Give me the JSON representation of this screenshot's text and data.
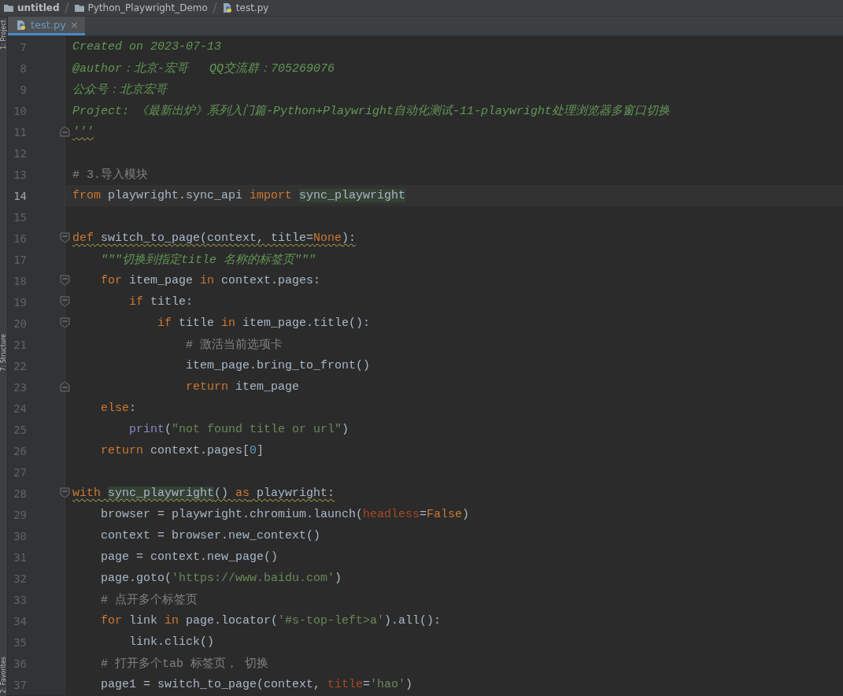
{
  "breadcrumbs": [
    {
      "label": "untitled",
      "kind": "project"
    },
    {
      "label": "Python_Playwright_Demo",
      "kind": "folder"
    },
    {
      "label": "test.py",
      "kind": "file"
    }
  ],
  "side_tools": [
    {
      "label": "1: Project"
    },
    {
      "label": "7: Structure"
    },
    {
      "label": "2: Favorites"
    }
  ],
  "tabs": [
    {
      "label": "test.py",
      "close": "×",
      "selected": true
    }
  ],
  "lines": [
    {
      "number": "7",
      "current": false,
      "underlined": false,
      "tokens": [
        {
          "kind": "doc",
          "text": "Created on 2023-07-13"
        }
      ]
    },
    {
      "number": "8",
      "current": false,
      "underlined": false,
      "tokens": [
        {
          "kind": "doc",
          "text": "@author：北京-宏哥   QQ交流群：705269076"
        }
      ]
    },
    {
      "number": "9",
      "current": false,
      "underlined": false,
      "tokens": [
        {
          "kind": "doc",
          "text": "公众号：北京宏哥"
        }
      ]
    },
    {
      "number": "10",
      "current": false,
      "underlined": false,
      "tokens": [
        {
          "kind": "doc",
          "text": "Project: 《最新出炉》系列入门篇-Python+Playwright自动化测试-11-playwright处理浏览器多窗口切换"
        }
      ]
    },
    {
      "number": "11",
      "current": false,
      "fold_marker": {
        "kind": "end"
      },
      "underlined": true,
      "tokens": [
        {
          "kind": "doc",
          "text": "'''"
        }
      ]
    },
    {
      "number": "12",
      "current": false
    },
    {
      "number": "13",
      "current": false,
      "underlined": false,
      "tokens": [
        {
          "kind": "comment",
          "text": "# 3.导入模块"
        }
      ]
    },
    {
      "number": "14",
      "current": true,
      "underlined": false,
      "tokens": [
        {
          "kind": "kw",
          "text": "from"
        },
        {
          "kind": "plain",
          "text": " playwright.sync_api "
        },
        {
          "kind": "kw",
          "text": "import"
        },
        {
          "kind": "usage",
          "text": " sync_playwright"
        }
      ]
    },
    {
      "number": "15",
      "current": false
    },
    {
      "number": "16",
      "current": false,
      "fold_marker": {
        "kind": "start"
      },
      "underlined": true,
      "tokens": [
        {
          "kind": "kw",
          "text": "def"
        },
        {
          "kind": "plain",
          "text": " switch_to_page(context, title="
        },
        {
          "kind": "kw",
          "text": "None"
        },
        {
          "kind": "plain",
          "text": "):"
        }
      ]
    },
    {
      "number": "17",
      "current": false,
      "underlined": false,
      "tokens": [
        {
          "kind": "doc",
          "text": "    \"\"\"切换到指定title 名称的标签页\"\"\""
        }
      ]
    },
    {
      "number": "18",
      "current": false,
      "fold_marker": {
        "kind": "start"
      },
      "underlined": false,
      "tokens": [
        {
          "kind": "kw",
          "text": "    for"
        },
        {
          "kind": "plain",
          "text": " item_page "
        },
        {
          "kind": "kw",
          "text": "in"
        },
        {
          "kind": "plain",
          "text": " context.pages:"
        }
      ]
    },
    {
      "number": "19",
      "current": false,
      "fold_marker": {
        "kind": "start"
      },
      "underlined": false,
      "tokens": [
        {
          "kind": "kw",
          "text": "        if"
        },
        {
          "kind": "plain",
          "text": " title:"
        }
      ]
    },
    {
      "number": "20",
      "current": false,
      "fold_marker": {
        "kind": "start"
      },
      "underlined": false,
      "tokens": [
        {
          "kind": "kw",
          "text": "            if"
        },
        {
          "kind": "plain",
          "text": " title "
        },
        {
          "kind": "kw",
          "text": "in"
        },
        {
          "kind": "plain",
          "text": " item_page.title():"
        }
      ]
    },
    {
      "number": "21",
      "current": false,
      "underlined": false,
      "tokens": [
        {
          "kind": "comment",
          "text": "                # 激活当前选项卡"
        }
      ]
    },
    {
      "number": "22",
      "current": false,
      "underlined": false,
      "tokens": [
        {
          "kind": "plain",
          "text": "                item_page.bring_to_front()"
        }
      ]
    },
    {
      "number": "23",
      "current": false,
      "fold_marker": {
        "kind": "end"
      },
      "underlined": false,
      "tokens": [
        {
          "kind": "kw",
          "text": "                return"
        },
        {
          "kind": "plain",
          "text": " item_page"
        }
      ]
    },
    {
      "number": "24",
      "current": false,
      "underlined": false,
      "tokens": [
        {
          "kind": "kw",
          "text": "    else"
        },
        {
          "kind": "plain",
          "text": ":"
        }
      ]
    },
    {
      "number": "25",
      "current": false,
      "underlined": false,
      "tokens": [
        {
          "kind": "builtin",
          "text": "        print"
        },
        {
          "kind": "plain",
          "text": "("
        },
        {
          "kind": "str",
          "text": "\"not found title or url\""
        },
        {
          "kind": "plain",
          "text": ")"
        }
      ]
    },
    {
      "number": "26",
      "current": false,
      "underlined": false,
      "tokens": [
        {
          "kind": "kw",
          "text": "    return"
        },
        {
          "kind": "plain",
          "text": " context.pages["
        },
        {
          "kind": "num",
          "text": "0"
        },
        {
          "kind": "plain",
          "text": "]"
        }
      ]
    },
    {
      "number": "27",
      "current": false
    },
    {
      "number": "28",
      "current": false,
      "fold_marker": {
        "kind": "start"
      },
      "underlined": true,
      "tokens": [
        {
          "kind": "kw",
          "text": "with"
        },
        {
          "kind": "usage",
          "text": " sync_playwright"
        },
        {
          "kind": "plain",
          "text": "() "
        },
        {
          "kind": "kw",
          "text": "as"
        },
        {
          "kind": "plain",
          "text": " playwright:"
        }
      ]
    },
    {
      "number": "29",
      "current": false,
      "underlined": false,
      "tokens": [
        {
          "kind": "plain",
          "text": "    browser = playwright.chromium.launch("
        },
        {
          "kind": "param",
          "text": "headless"
        },
        {
          "kind": "plain",
          "text": "="
        },
        {
          "kind": "kw",
          "text": "False"
        },
        {
          "kind": "plain",
          "text": ")"
        }
      ]
    },
    {
      "number": "30",
      "current": false,
      "underlined": false,
      "tokens": [
        {
          "kind": "plain",
          "text": "    context = browser.new_context()"
        }
      ]
    },
    {
      "number": "31",
      "current": false,
      "underlined": false,
      "tokens": [
        {
          "kind": "plain",
          "text": "    page = context.new_page()"
        }
      ]
    },
    {
      "number": "32",
      "current": false,
      "underlined": false,
      "tokens": [
        {
          "kind": "plain",
          "text": "    page.goto("
        },
        {
          "kind": "str",
          "text": "'https://www.baidu.com'"
        },
        {
          "kind": "plain",
          "text": ")"
        }
      ]
    },
    {
      "number": "33",
      "current": false,
      "underlined": false,
      "tokens": [
        {
          "kind": "comment",
          "text": "    # 点开多个标签页"
        }
      ]
    },
    {
      "number": "34",
      "current": false,
      "underlined": false,
      "tokens": [
        {
          "kind": "kw",
          "text": "    for"
        },
        {
          "kind": "plain",
          "text": " link "
        },
        {
          "kind": "kw",
          "text": "in"
        },
        {
          "kind": "plain",
          "text": " page.locator("
        },
        {
          "kind": "str",
          "text": "'#s-top-left>a'"
        },
        {
          "kind": "plain",
          "text": ").all():"
        }
      ]
    },
    {
      "number": "35",
      "current": false,
      "underlined": false,
      "tokens": [
        {
          "kind": "plain",
          "text": "        link.click()"
        }
      ]
    },
    {
      "number": "36",
      "current": false,
      "underlined": false,
      "tokens": [
        {
          "kind": "comment",
          "text": "    # 打开多个tab 标签页， 切换"
        }
      ]
    },
    {
      "number": "37",
      "current": false,
      "underlined": false,
      "tokens": [
        {
          "kind": "plain",
          "text": "    page1 = switch_to_page(context, "
        },
        {
          "kind": "param",
          "text": "title"
        },
        {
          "kind": "plain",
          "text": "="
        },
        {
          "kind": "str",
          "text": "'hao'"
        },
        {
          "kind": "plain",
          "text": ")"
        }
      ]
    }
  ]
}
